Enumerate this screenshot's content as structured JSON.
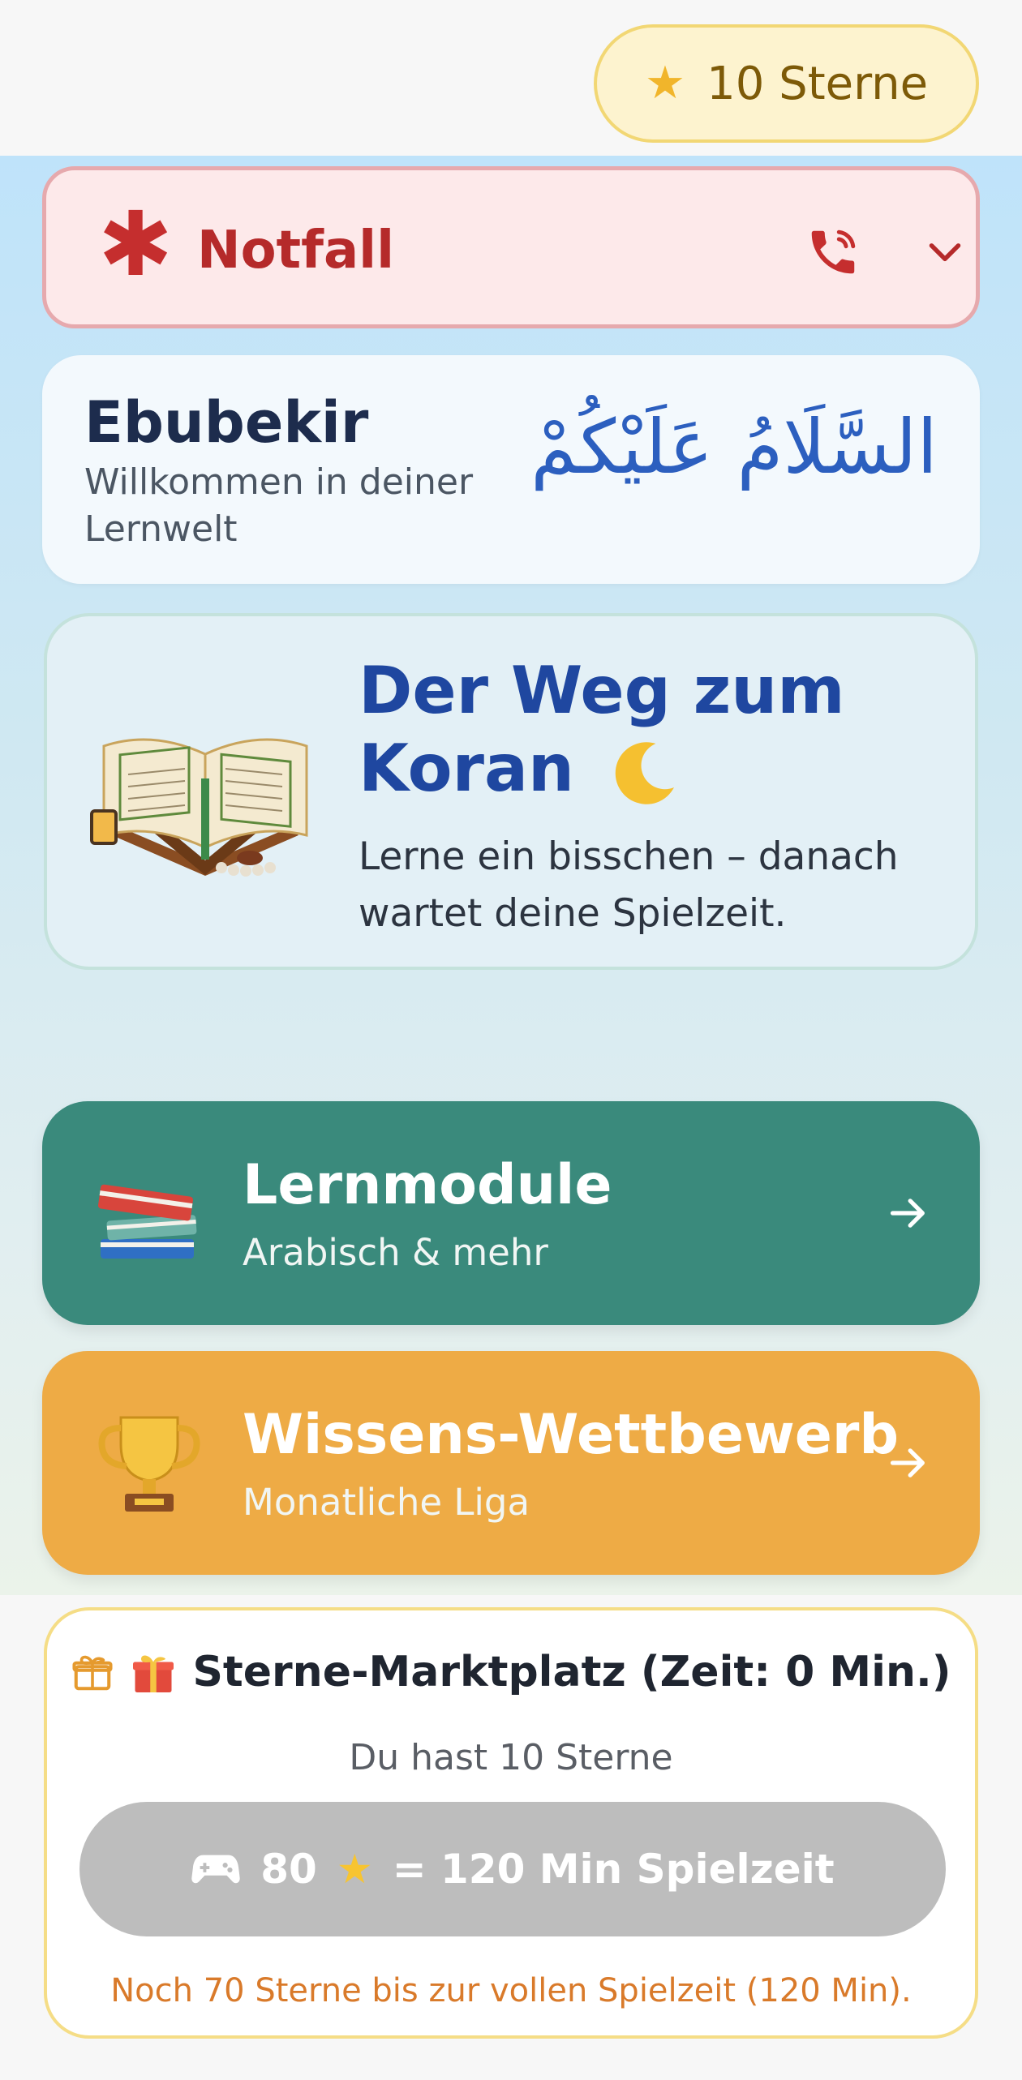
{
  "header": {
    "stars_label": "10 Sterne",
    "star_icon": "star-icon",
    "accent_color": "#f1b52b"
  },
  "emergency": {
    "label": "Notfall",
    "icons": [
      "asterisk-icon",
      "phone-icon",
      "chevron-down-icon"
    ],
    "color": "#c52e2e"
  },
  "welcome": {
    "name": "Ebubekir",
    "subtitle": "Willkommen in deiner Lernwelt",
    "arabic_greeting": "السَّلَامُ عَلَيْكُمْ"
  },
  "hero": {
    "title": "Der Weg zum Koran",
    "description": "Lerne ein bisschen – danach wartet deine Spielzeit.",
    "icons": [
      "quran-book-icon",
      "crescent-moon-icon"
    ]
  },
  "modules": [
    {
      "title": "Lernmodule",
      "subtitle": "Arabisch & mehr",
      "icon": "books-icon",
      "color": "#3a8a7c"
    },
    {
      "title": "Wissens-Wettbewerb",
      "subtitle": "Monatliche Liga",
      "icon": "trophy-icon",
      "color": "#eeab45"
    }
  ],
  "market": {
    "title": "Sterne-Marktplatz (Zeit: 0 Min.)",
    "balance_text": "Du hast 10 Sterne",
    "button_label_cost": "80",
    "button_label_rest": "= 120 Min Spielzeit",
    "note": "Noch 70 Sterne bis zur vollen Spielzeit (120 Min).",
    "icons": [
      "gift-box-icon",
      "gift-emoji-icon",
      "gamepad-icon",
      "star-icon"
    ]
  }
}
